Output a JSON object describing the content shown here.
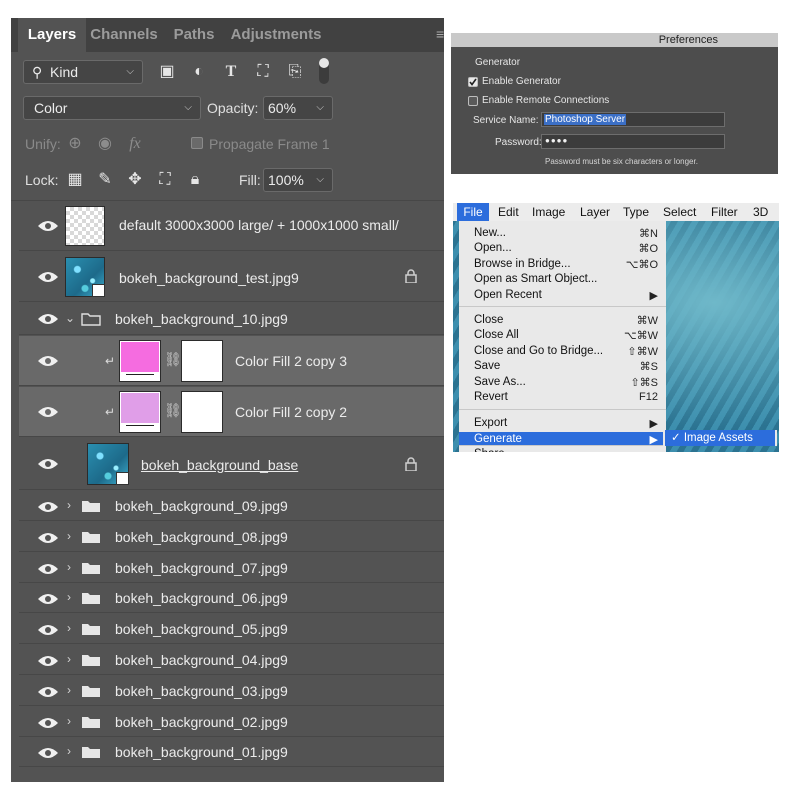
{
  "layers_panel": {
    "tabs": [
      "Layers",
      "Channels",
      "Paths",
      "Adjustments"
    ],
    "filter_kind": "Kind",
    "blend_mode": "Color",
    "opacity_label": "Opacity:",
    "opacity_value": "60%",
    "unify_label": "Unify:",
    "propagate_label": "Propagate Frame 1",
    "lock_label": "Lock:",
    "fill_label": "Fill:",
    "fill_value": "100%",
    "layers": [
      {
        "name": "default 3000x3000 large/ + 1000x1000 small/"
      },
      {
        "name": "bokeh_background_test.jpg9"
      },
      {
        "name": "bokeh_background_10.jpg9"
      },
      {
        "name": "Color Fill 2 copy 3",
        "color": "#f56ce0"
      },
      {
        "name": "Color Fill 2 copy 2",
        "color": "#e09ee8"
      },
      {
        "name": "bokeh_background_base"
      },
      {
        "name": "bokeh_background_09.jpg9"
      },
      {
        "name": "bokeh_background_08.jpg9"
      },
      {
        "name": "bokeh_background_07.jpg9"
      },
      {
        "name": "bokeh_background_06.jpg9"
      },
      {
        "name": "bokeh_background_05.jpg9"
      },
      {
        "name": "bokeh_background_04.jpg9"
      },
      {
        "name": "bokeh_background_03.jpg9"
      },
      {
        "name": "bokeh_background_02.jpg9"
      },
      {
        "name": "bokeh_background_01.jpg9"
      }
    ]
  },
  "preferences": {
    "title": "Preferences",
    "section": "Generator",
    "enable_generator": "Enable Generator",
    "enable_remote": "Enable Remote Connections",
    "service_name_label": "Service Name:",
    "service_name_value": "Photoshop Server",
    "password_label": "Password:",
    "password_value": "●●●●",
    "password_hint": "Password must be six characters or longer."
  },
  "file_menu": {
    "menubar": [
      "File",
      "Edit",
      "Image",
      "Layer",
      "Type",
      "Select",
      "Filter",
      "3D"
    ],
    "items": [
      {
        "label": "New...",
        "key": "⌘N"
      },
      {
        "label": "Open...",
        "key": "⌘O"
      },
      {
        "label": "Browse in Bridge...",
        "key": "⌥⌘O"
      },
      {
        "label": "Open as Smart Object...",
        "key": ""
      },
      {
        "label": "Open Recent",
        "key": "▶"
      },
      {
        "label": "Close",
        "key": "⌘W"
      },
      {
        "label": "Close All",
        "key": "⌥⌘W"
      },
      {
        "label": "Close and Go to Bridge...",
        "key": "⇧⌘W"
      },
      {
        "label": "Save",
        "key": "⌘S"
      },
      {
        "label": "Save As...",
        "key": "⇧⌘S"
      },
      {
        "label": "Revert",
        "key": "F12"
      },
      {
        "label": "Export",
        "key": "▶"
      },
      {
        "label": "Generate",
        "key": "▶"
      },
      {
        "label": "Share...",
        "key": ""
      }
    ],
    "submenu_item": "✓ Image Assets"
  }
}
